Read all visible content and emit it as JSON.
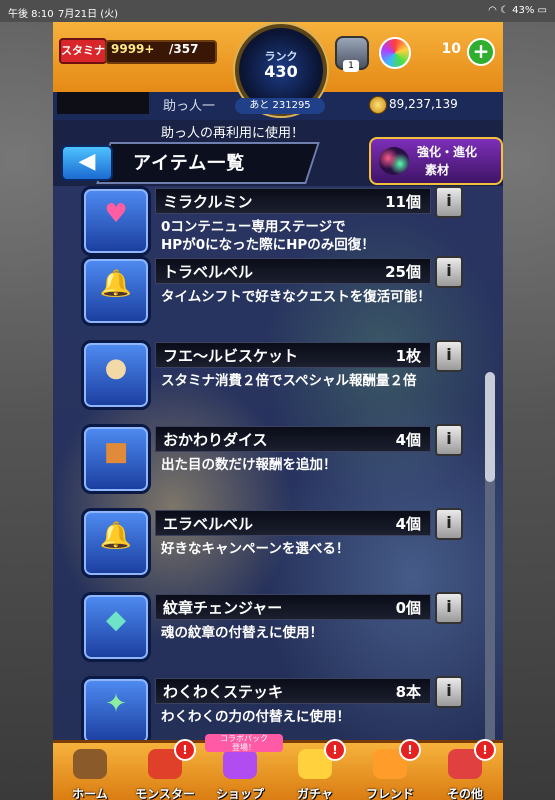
{
  "status_bar": {
    "time": "午後 8:10",
    "date": "7月21日 (火)",
    "battery": "43%"
  },
  "topbar": {
    "stamina_label": "スタミナ",
    "stamina_value": "9999+",
    "stamina_max": "/357",
    "rank_label": "ランク",
    "rank_value": "430",
    "rank_next": "あと 231295",
    "helper_count": "1",
    "orb_count": "10",
    "plus": "+"
  },
  "subbar": {
    "helper_title": "助っ人一",
    "coins": "89,237,139",
    "partial_text": "助っ人の再利用に使用！"
  },
  "header": {
    "back": "◀",
    "title": "アイテム一覧",
    "evolve_line1": "強化・進化",
    "evolve_line2": "素材"
  },
  "items": [
    {
      "name": "ミラクルミン",
      "count": "11個",
      "desc1": "0コンテニュー専用ステージで",
      "desc2": "HPが0になった際にHPのみ回復！",
      "icon": "heart-potion-icon",
      "glyph": "♥",
      "glyph_color": "#ff5fa2"
    },
    {
      "name": "トラベルベル",
      "count": "25個",
      "desc1": "タイムシフトで好きなクエストを復活可能！",
      "desc2": "",
      "icon": "travel-bell-icon",
      "glyph": "🔔",
      "glyph_color": "#c8d6e8"
    },
    {
      "name": "フエ〜ルビスケット",
      "count": "1枚",
      "desc1": "スタミナ消費２倍でスペシャル報酬量２倍",
      "desc2": "",
      "icon": "biscuit-icon",
      "glyph": "●",
      "glyph_color": "#f2d9a6"
    },
    {
      "name": "おかわりダイス",
      "count": "4個",
      "desc1": "出た目の数だけ報酬を追加！",
      "desc2": "",
      "icon": "dice-icon",
      "glyph": "■",
      "glyph_color": "#e08a3a"
    },
    {
      "name": "エラベルベル",
      "count": "4個",
      "desc1": "好きなキャンペーンを選べる！",
      "desc2": "",
      "icon": "gold-bell-icon",
      "glyph": "🔔",
      "glyph_color": "#ffc93c"
    },
    {
      "name": "紋章チェンジャー",
      "count": "0個",
      "desc1": "魂の紋章の付替えに使用！",
      "desc2": "",
      "icon": "emblem-icon",
      "glyph": "◆",
      "glyph_color": "#6ee3c8"
    },
    {
      "name": "わくわくステッキ",
      "count": "8本",
      "desc1": "わくわくの力の付替えに使用！",
      "desc2": "",
      "icon": "wand-icon",
      "glyph": "✦",
      "glyph_color": "#8cf0a0"
    }
  ],
  "nav": [
    {
      "label": "ホーム",
      "badge": "",
      "color": "#8a5a2a"
    },
    {
      "label": "モンスター",
      "badge": "!",
      "color": "#e0402a"
    },
    {
      "label": "ショップ",
      "badge": "",
      "color": "#b04cf0"
    },
    {
      "label": "ガチャ",
      "badge": "!",
      "color": "#ffd23d"
    },
    {
      "label": "フレンド",
      "badge": "!",
      "color": "#ff9c2a"
    },
    {
      "label": "その他",
      "badge": "!",
      "color": "#e04040"
    }
  ],
  "collab_tag": "コラボパック\n登場！"
}
